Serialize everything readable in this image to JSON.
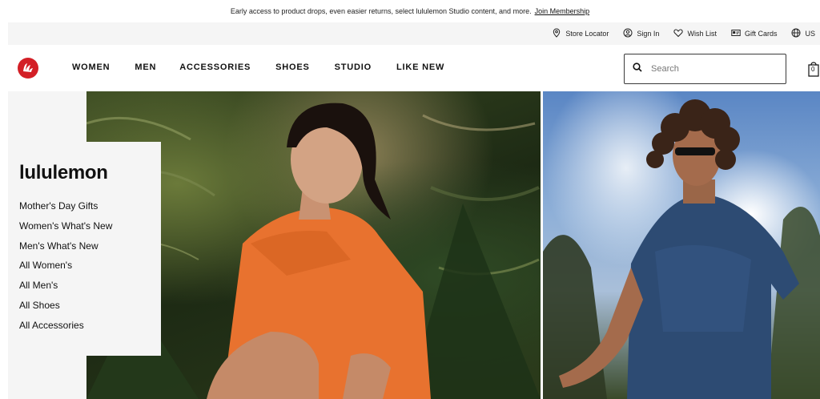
{
  "announcement": {
    "text": "Early access to product drops, even easier returns, select lululemon Studio content, and more.",
    "link": "Join Membership"
  },
  "utility": {
    "items": [
      {
        "label": "Store Locator",
        "icon": "location-pin-icon"
      },
      {
        "label": "Sign In",
        "icon": "user-icon"
      },
      {
        "label": "Wish List",
        "icon": "heart-icon"
      },
      {
        "label": "Gift Cards",
        "icon": "gift-card-icon"
      },
      {
        "label": "US",
        "icon": "globe-icon"
      }
    ]
  },
  "nav": {
    "brand_icon": "lululemon-logo-icon",
    "brand_color": "#d31f26",
    "items": [
      "WOMEN",
      "MEN",
      "ACCESSORIES",
      "SHOES",
      "STUDIO",
      "LIKE NEW"
    ]
  },
  "search": {
    "placeholder": "Search"
  },
  "bag": {
    "count": "0"
  },
  "panel": {
    "title": "lululemon",
    "links": [
      "Mother's Day Gifts",
      "Women's What's New",
      "Men's What's New",
      "All Women's",
      "All Men's",
      "All Shoes",
      "All Accessories"
    ]
  }
}
